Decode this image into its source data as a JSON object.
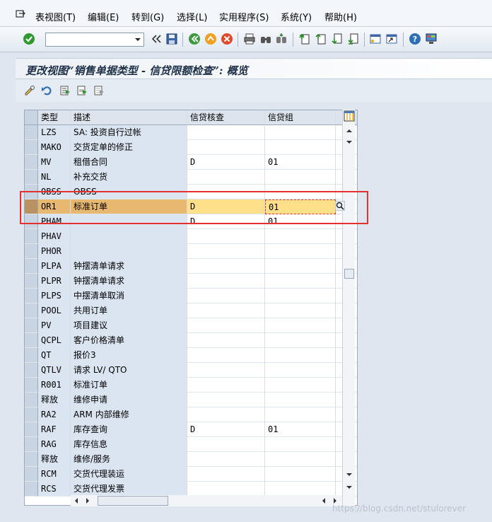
{
  "menu": {
    "items": [
      "表视图(T)",
      "编辑(E)",
      "转到(G)",
      "选择(L)",
      "实用程序(S)",
      "系统(Y)",
      "帮助(H)"
    ]
  },
  "toolbar": {
    "command_value": "",
    "icons": [
      "enter-icon",
      "save-icon",
      "back-icon",
      "exit-icon",
      "cancel-icon",
      "print-icon",
      "find-icon",
      "find-next-icon",
      "first-page-icon",
      "prev-page-icon",
      "next-page-icon",
      "last-page-icon",
      "new-session-icon",
      "shortcut-icon",
      "help-icon",
      "layout-icon"
    ]
  },
  "title": "更改视图“销售单据类型 - 信贷限额检查”: 概览",
  "table": {
    "headers": [
      "类型",
      "描述",
      "信贷核查",
      "信贷组"
    ],
    "rows": [
      {
        "type": "LZS",
        "desc": "SA: 投资自行过帐",
        "check": "",
        "group": ""
      },
      {
        "type": "MAKO",
        "desc": "交货定单的修正",
        "check": "",
        "group": ""
      },
      {
        "type": "MV",
        "desc": "租借合同",
        "check": "D",
        "group": "01"
      },
      {
        "type": "NL",
        "desc": "补充交货",
        "check": "",
        "group": ""
      },
      {
        "type": "OBSS",
        "desc": "OBSS",
        "check": "",
        "group": ""
      },
      {
        "type": "OR1",
        "desc": "标准订单",
        "check": "D",
        "group": "01",
        "highlighted": true
      },
      {
        "type": "PHAM",
        "desc": "",
        "check": "D",
        "group": "01"
      },
      {
        "type": "PHAV",
        "desc": "",
        "check": "",
        "group": ""
      },
      {
        "type": "PHOR",
        "desc": "",
        "check": "",
        "group": ""
      },
      {
        "type": "PLPA",
        "desc": "钟摆清单请求",
        "check": "",
        "group": ""
      },
      {
        "type": "PLPR",
        "desc": "钟摆清单请求",
        "check": "",
        "group": ""
      },
      {
        "type": "PLPS",
        "desc": "中摆清单取消",
        "check": "",
        "group": ""
      },
      {
        "type": "POOL",
        "desc": "共用订单",
        "check": "",
        "group": ""
      },
      {
        "type": "PV",
        "desc": "项目建议",
        "check": "",
        "group": ""
      },
      {
        "type": "QCPL",
        "desc": "客户价格清单",
        "check": "",
        "group": ""
      },
      {
        "type": "QT",
        "desc": "报价3",
        "check": "",
        "group": ""
      },
      {
        "type": "QTLV",
        "desc": "请求 LV/ QTO",
        "check": "",
        "group": ""
      },
      {
        "type": "R001",
        "desc": "标准订单",
        "check": "",
        "group": ""
      },
      {
        "type": "释放",
        "desc": "维修申请",
        "check": "",
        "group": ""
      },
      {
        "type": "RA2",
        "desc": "ARM 内部维修",
        "check": "",
        "group": ""
      },
      {
        "type": "RAF",
        "desc": "库存查询",
        "check": "D",
        "group": "01"
      },
      {
        "type": "RAG",
        "desc": "库存信息",
        "check": "",
        "group": ""
      },
      {
        "type": "释放",
        "desc": "维修/服务",
        "check": "",
        "group": ""
      },
      {
        "type": "RCM",
        "desc": "交货代理装运",
        "check": "",
        "group": ""
      },
      {
        "type": "RCS",
        "desc": "交货代理发票",
        "check": "",
        "group": ""
      }
    ]
  },
  "watermark": "https://blog.csdn.net/stulorever",
  "colors": {
    "highlight_key": "#e8b870",
    "highlight_input": "#ffe08a",
    "annotation_red": "#e53030",
    "enter_green": "#2e9a2e"
  }
}
